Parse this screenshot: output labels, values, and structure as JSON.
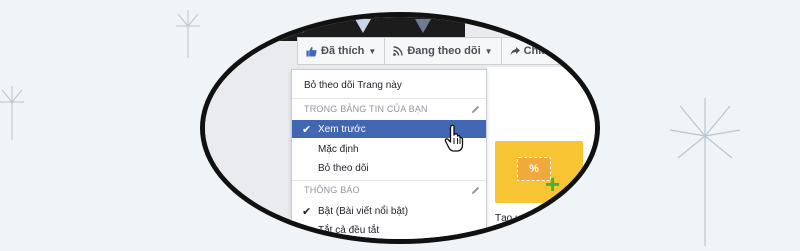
{
  "toolbar": {
    "liked_label": "Đã thích",
    "following_label": "Đang theo dõi",
    "share_label": "Chia s"
  },
  "menu": {
    "unfollow_page": "Bỏ theo dõi Trang này",
    "section_newsfeed": "TRONG BẢNG TIN CỦA BẠN",
    "see_first": "Xem trước",
    "default": "Mặc định",
    "unfollow": "Bỏ theo dõi",
    "section_notifications": "THÔNG BÁO",
    "on_highlights": "Bật (Bài viết nổi bật)",
    "all_off": "Tắt cả đều tắt"
  },
  "promo": {
    "label": "Tạo ưu đãi",
    "ticket_symbol": "%"
  },
  "colors": {
    "accent": "#4267b2",
    "promo_bg": "#f7c534",
    "plus_green": "#42b72a"
  }
}
